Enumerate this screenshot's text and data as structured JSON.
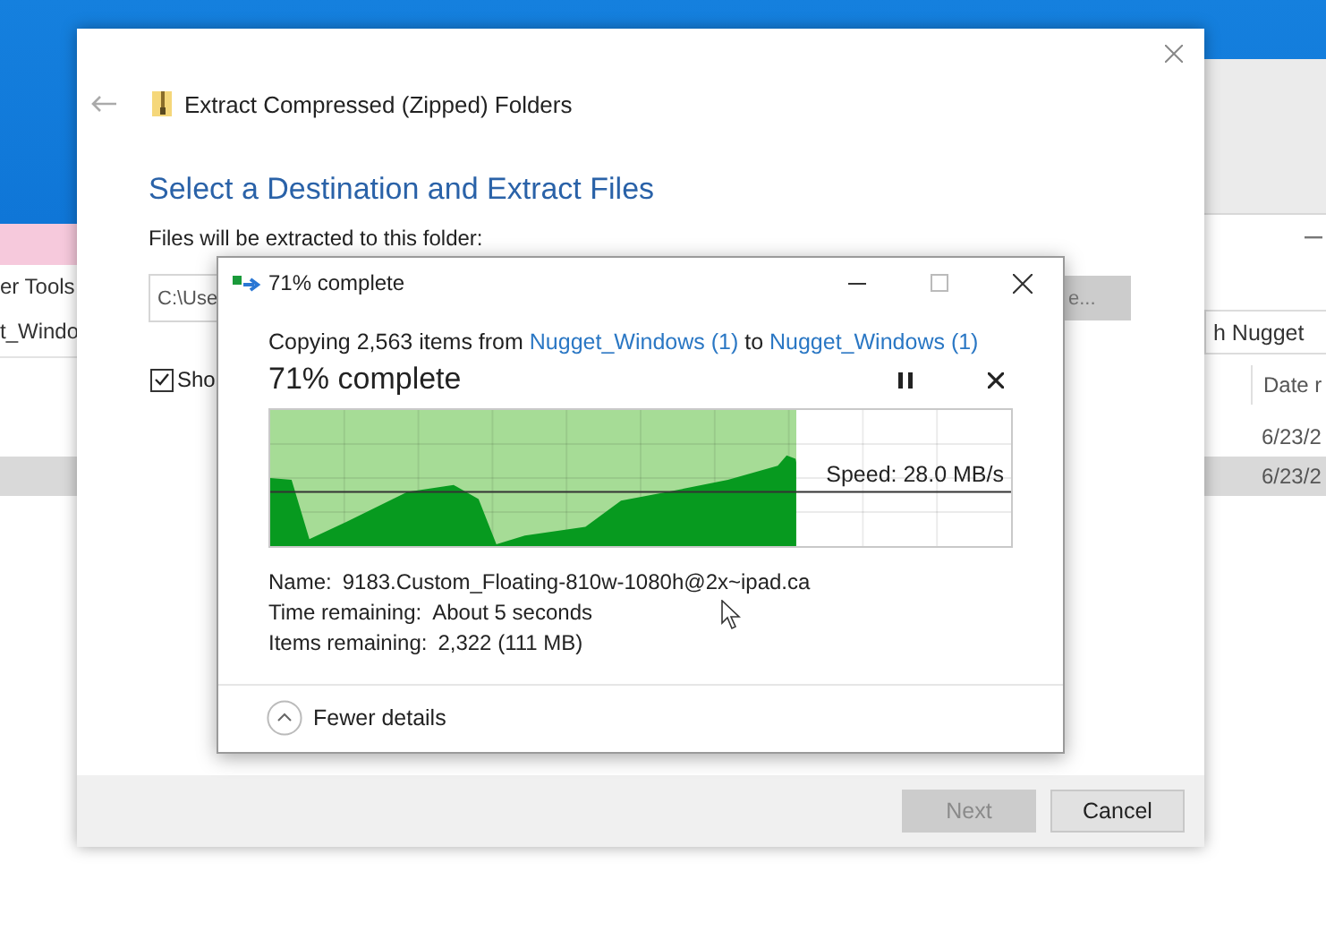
{
  "explorer": {
    "ribbon_tab": "er Tools",
    "address": "t_Windo",
    "search": "h Nugget",
    "column": "Date r",
    "rows": [
      {
        "date": "6/23/2",
        "selected": false
      },
      {
        "date": "6/23/2",
        "selected": true
      }
    ]
  },
  "wizard": {
    "title": "Extract Compressed (Zipped) Folders",
    "heading": "Select a Destination and Extract Files",
    "folder_label": "Files will be extracted to this folder:",
    "path_field": {
      "value": "C:\\Use"
    },
    "browse_button": "e...",
    "show_files": {
      "label": "Sho",
      "checked": true
    },
    "buttons": [
      {
        "label": "Next",
        "disabled": true
      },
      {
        "label": "Cancel",
        "disabled": false
      }
    ]
  },
  "copy_dialog": {
    "title": "71% complete",
    "description": {
      "prefix": "Copying 2,563 items from",
      "source": "Nugget_Windows (1)",
      "joiner": "to",
      "destination": "Nugget_Windows (1)"
    },
    "status": "71% complete",
    "progress": {
      "level": 0.71,
      "speed": "Speed: 28.0 MB/s"
    },
    "details": [
      {
        "label": "Name:",
        "value": "9183.Custom_Floating-810w-1080h@2x~ipad.ca"
      },
      {
        "label": "Time remaining:",
        "value": "About 5 seconds"
      },
      {
        "label": "Items remaining:",
        "value": "2,322 (111 MB)"
      }
    ],
    "toggle": "Fewer details"
  }
}
